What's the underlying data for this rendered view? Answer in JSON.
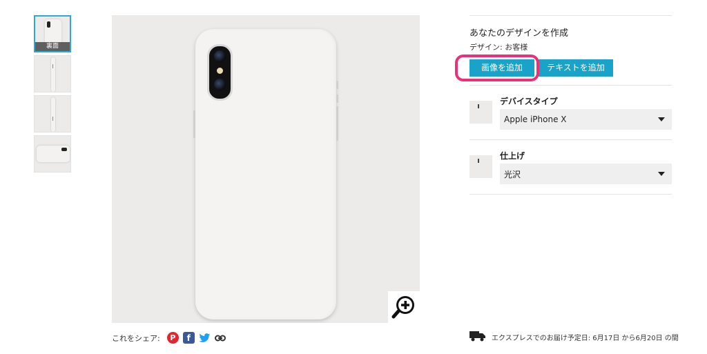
{
  "thumbnails": {
    "active_caption": "裏面"
  },
  "design": {
    "title": "あなたのデザインを作成",
    "designed_by": "デザイン: お客様",
    "add_image_label": "画像を追加",
    "add_text_label": "テキストを追加"
  },
  "options": {
    "device_type_label": "デバイスタイプ",
    "device_type_value": "Apple iPhone X",
    "finish_label": "仕上げ",
    "finish_value": "光沢"
  },
  "share": {
    "label": "これをシェア:"
  },
  "delivery": {
    "text": "エクスプレスでのお届け予定日: 6月17日 から6月20日 の間"
  },
  "colors": {
    "accent_button": "#1aa3c8",
    "highlight_ring": "#ec2f7b",
    "active_thumb_border": "#29a9d4"
  }
}
